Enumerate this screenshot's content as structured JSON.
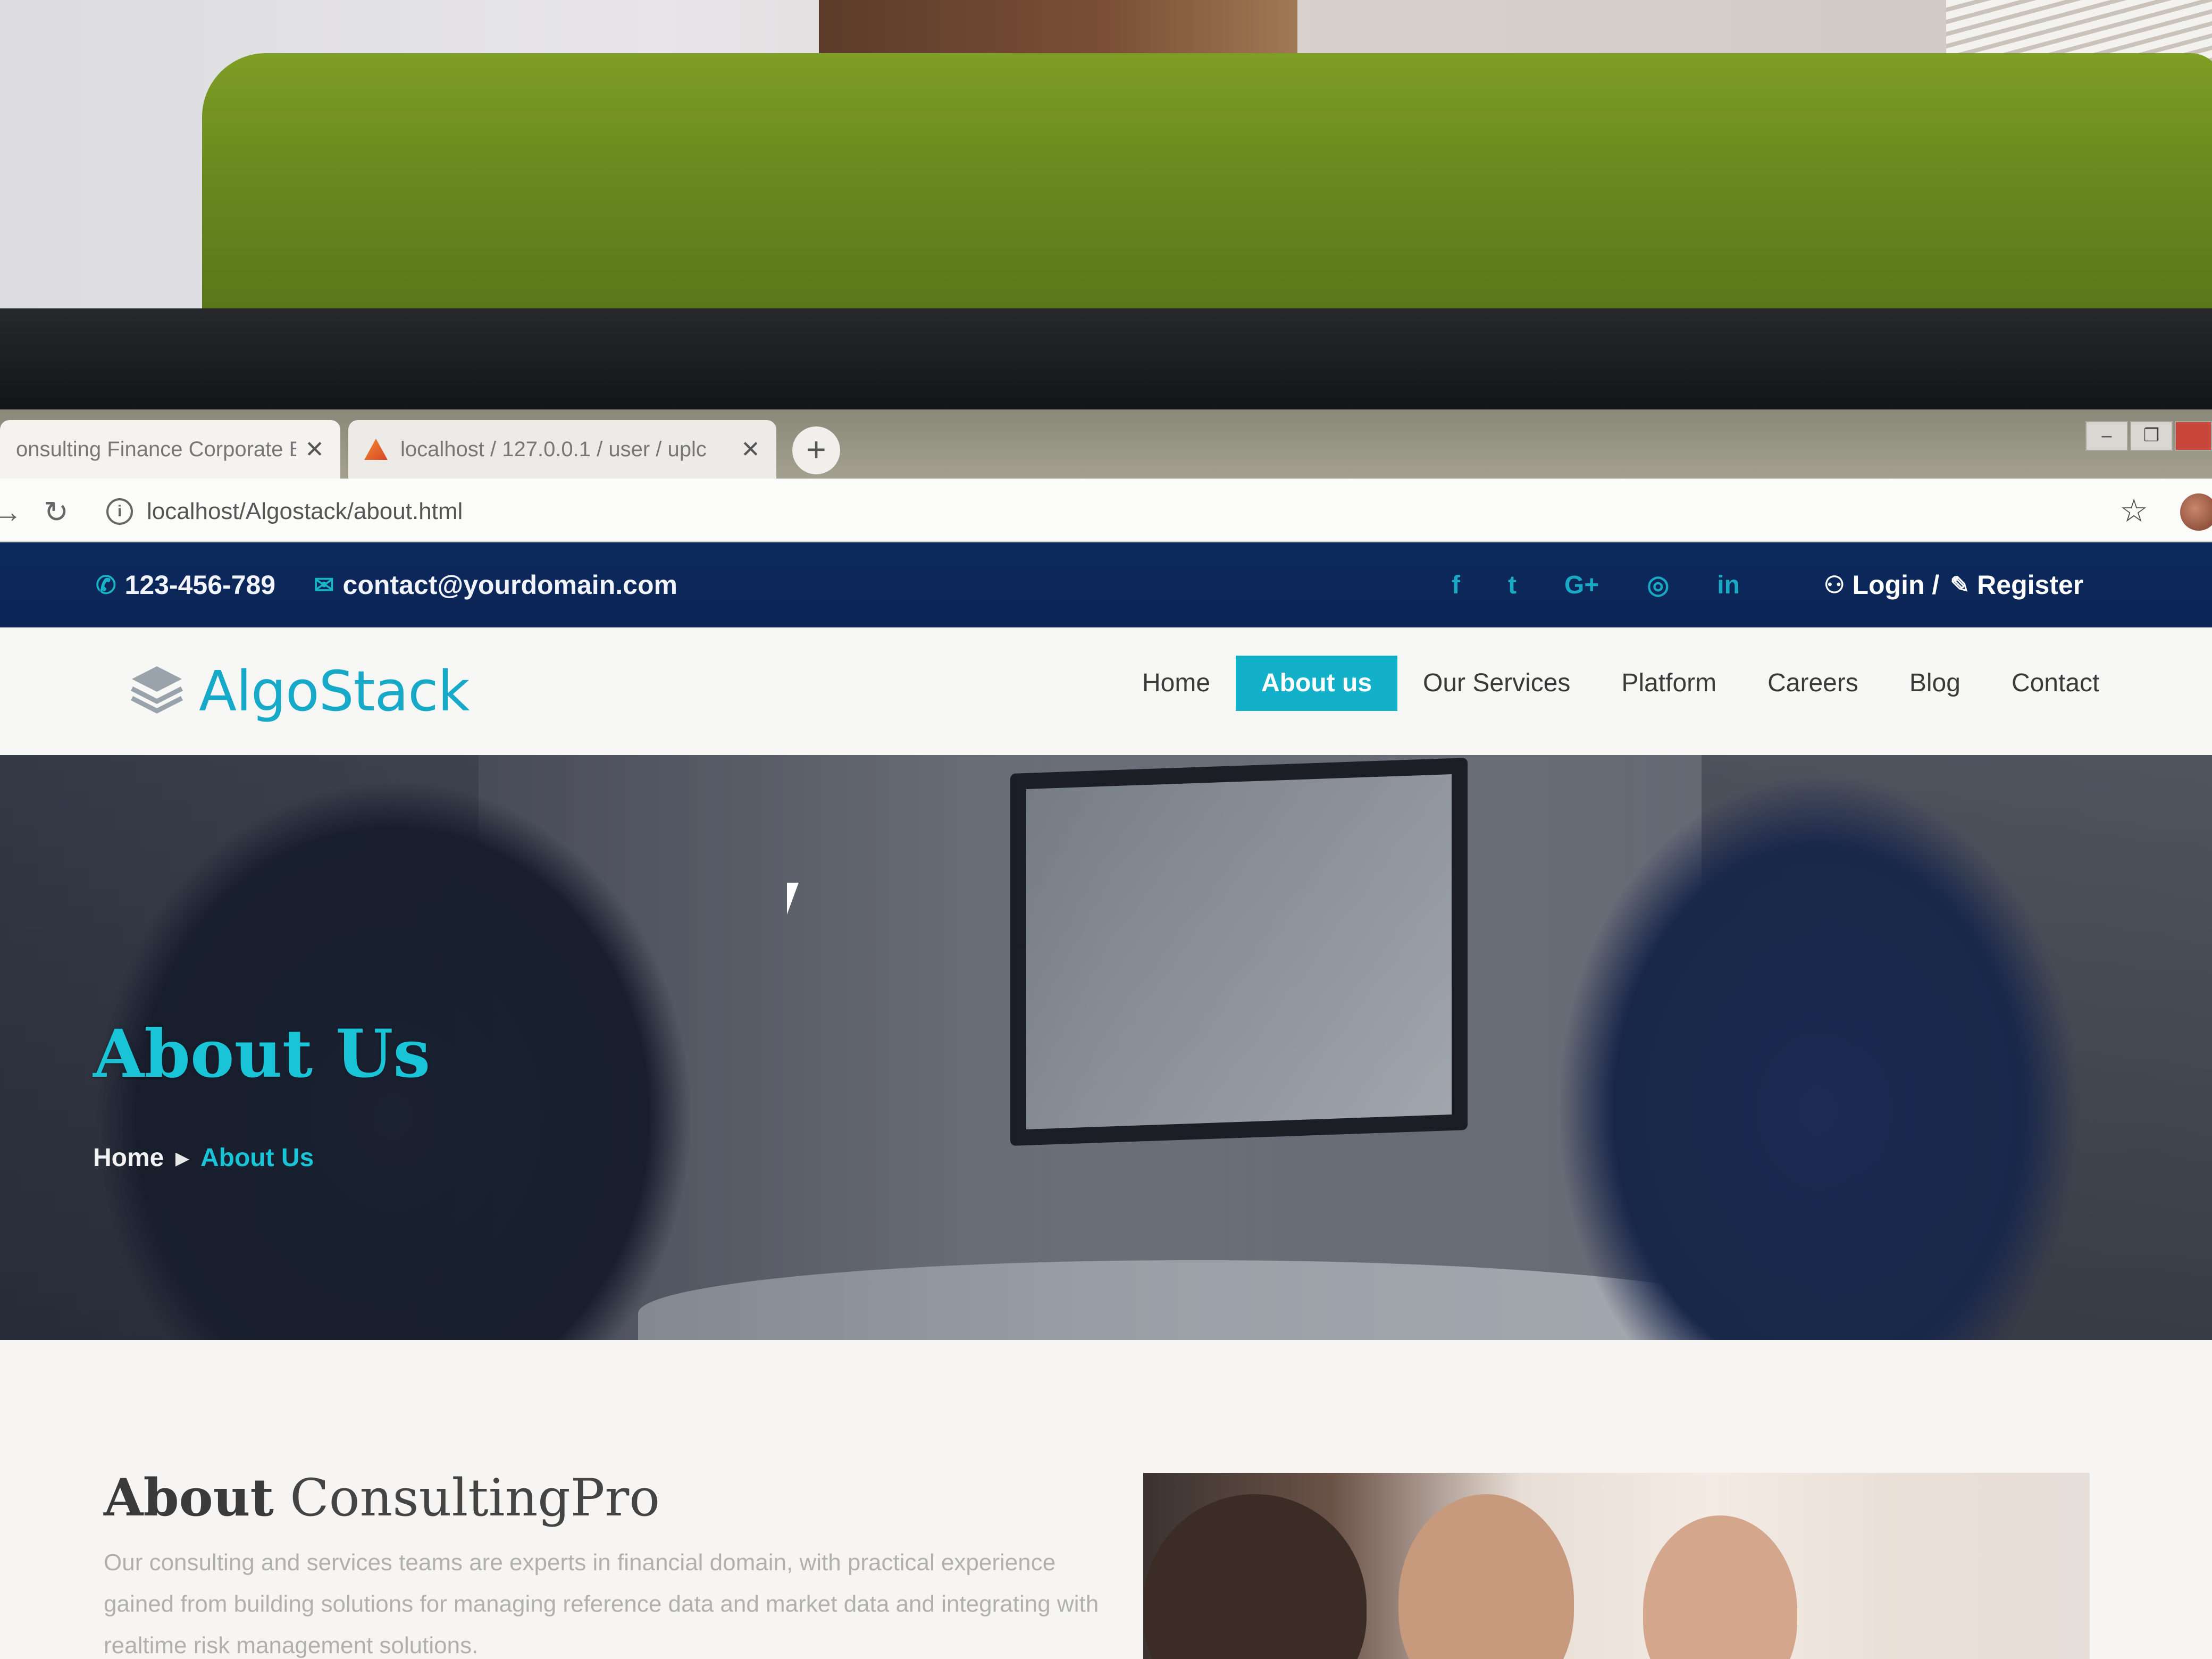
{
  "browser": {
    "tabs": [
      {
        "title": "onsulting Finance Corporate B",
        "close": "✕",
        "active": true
      },
      {
        "title": "localhost / 127.0.0.1 / user / uplc",
        "close": "✕",
        "active": false
      }
    ],
    "newtab_label": "+",
    "url": "localhost/Algostack/about.html"
  },
  "topbar": {
    "phone": "123-456-789",
    "email": "contact@yourdomain.com",
    "social": [
      "f",
      "t",
      "G+",
      "◎",
      "in"
    ],
    "login": "Login /",
    "register": "Register"
  },
  "header": {
    "logo_text": "AlgoStack",
    "nav": [
      {
        "label": "Home",
        "active": false
      },
      {
        "label": "About us",
        "active": true
      },
      {
        "label": "Our Services",
        "active": false
      },
      {
        "label": "Platform",
        "active": false
      },
      {
        "label": "Careers",
        "active": false
      },
      {
        "label": "Blog",
        "active": false
      },
      {
        "label": "Contact",
        "active": false
      }
    ]
  },
  "hero": {
    "title": "About Us",
    "breadcrumb": {
      "home": "Home",
      "separator": "▶",
      "current": "About Us"
    }
  },
  "about": {
    "title_bold": "About",
    "title_rest": " ConsultingPro",
    "text": "Our consulting and services teams are experts in financial domain, with practical experience gained from building solutions for managing reference data and market data and integrating with realtime risk management solutions."
  },
  "colors": {
    "accent": "#12b0c9",
    "topbar_bg": "#0d2a5e",
    "hero_title": "#18c4d6"
  }
}
